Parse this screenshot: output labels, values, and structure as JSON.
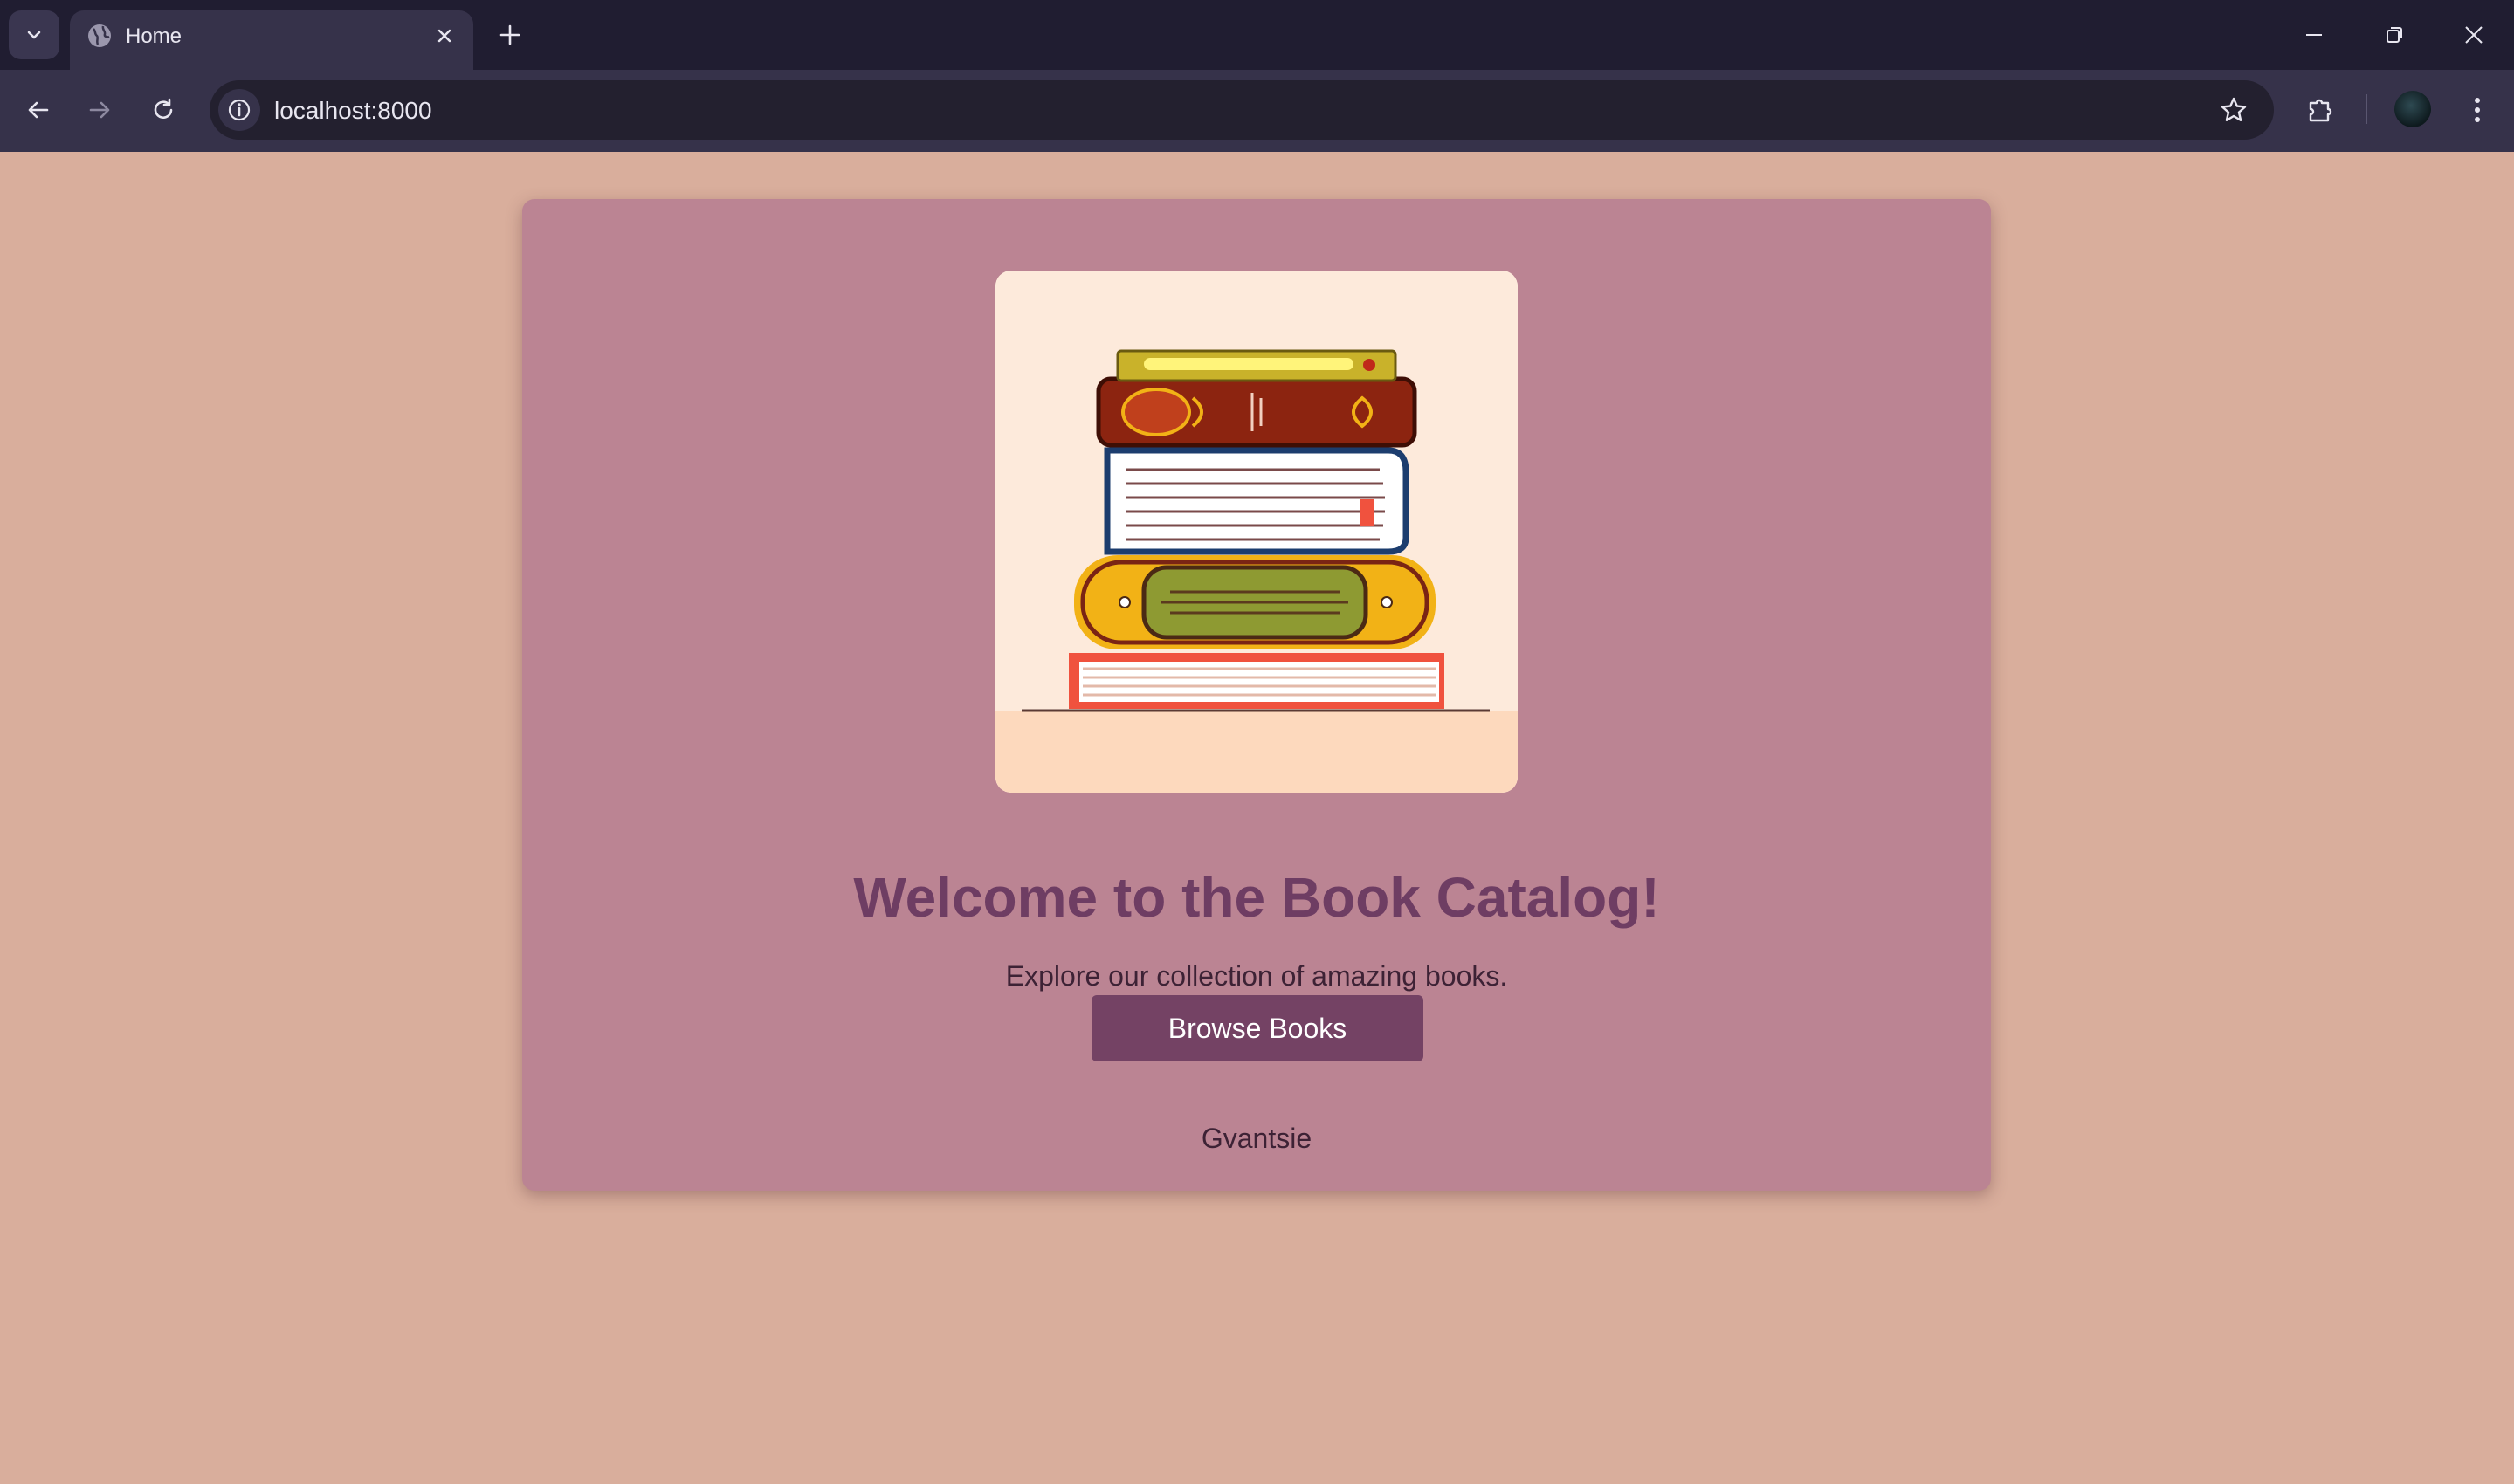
{
  "browser": {
    "tab_title": "Home",
    "url": "localhost:8000"
  },
  "page": {
    "title": "Welcome to the Book Catalog!",
    "subtitle": "Explore our collection of amazing books.",
    "button_label": "Browse Books",
    "author": "Gvantsie",
    "image_alt": "stack-of-books-illustration"
  },
  "colors": {
    "background": "#d9ae9c",
    "card": "#bb8493",
    "title": "#6e3d63",
    "button": "#744264",
    "tabstrip": "#201d31",
    "toolbar": "#36324a"
  },
  "icons": [
    "tab-search-icon",
    "globe-icon",
    "close-icon",
    "plus-icon",
    "minimize-icon",
    "restore-icon",
    "back-icon",
    "forward-icon",
    "reload-icon",
    "info-icon",
    "star-icon",
    "puzzle-icon",
    "kebab-menu-icon"
  ]
}
